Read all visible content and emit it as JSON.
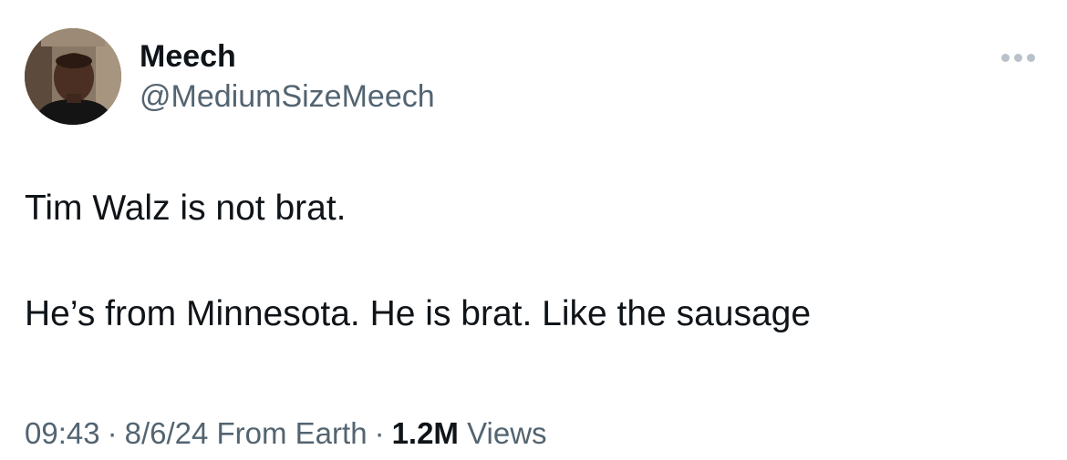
{
  "author": {
    "display_name": "Meech",
    "handle": "@MediumSizeMeech"
  },
  "tweet": {
    "line1": "Tim Walz is not brat.",
    "line2": "He’s from Minnesota. He is brat. Like the sausage"
  },
  "meta": {
    "time": "09:43",
    "date": "8/6/24",
    "location": "From Earth",
    "separator": "·",
    "views_count": "1.2M",
    "views_label": "Views"
  },
  "icons": {
    "more": "more-options-icon",
    "avatar": "profile-photo"
  },
  "colors": {
    "primary_text": "#0f1419",
    "secondary_text": "#536471",
    "more_dots": "#b9c2ca",
    "background": "#ffffff"
  }
}
